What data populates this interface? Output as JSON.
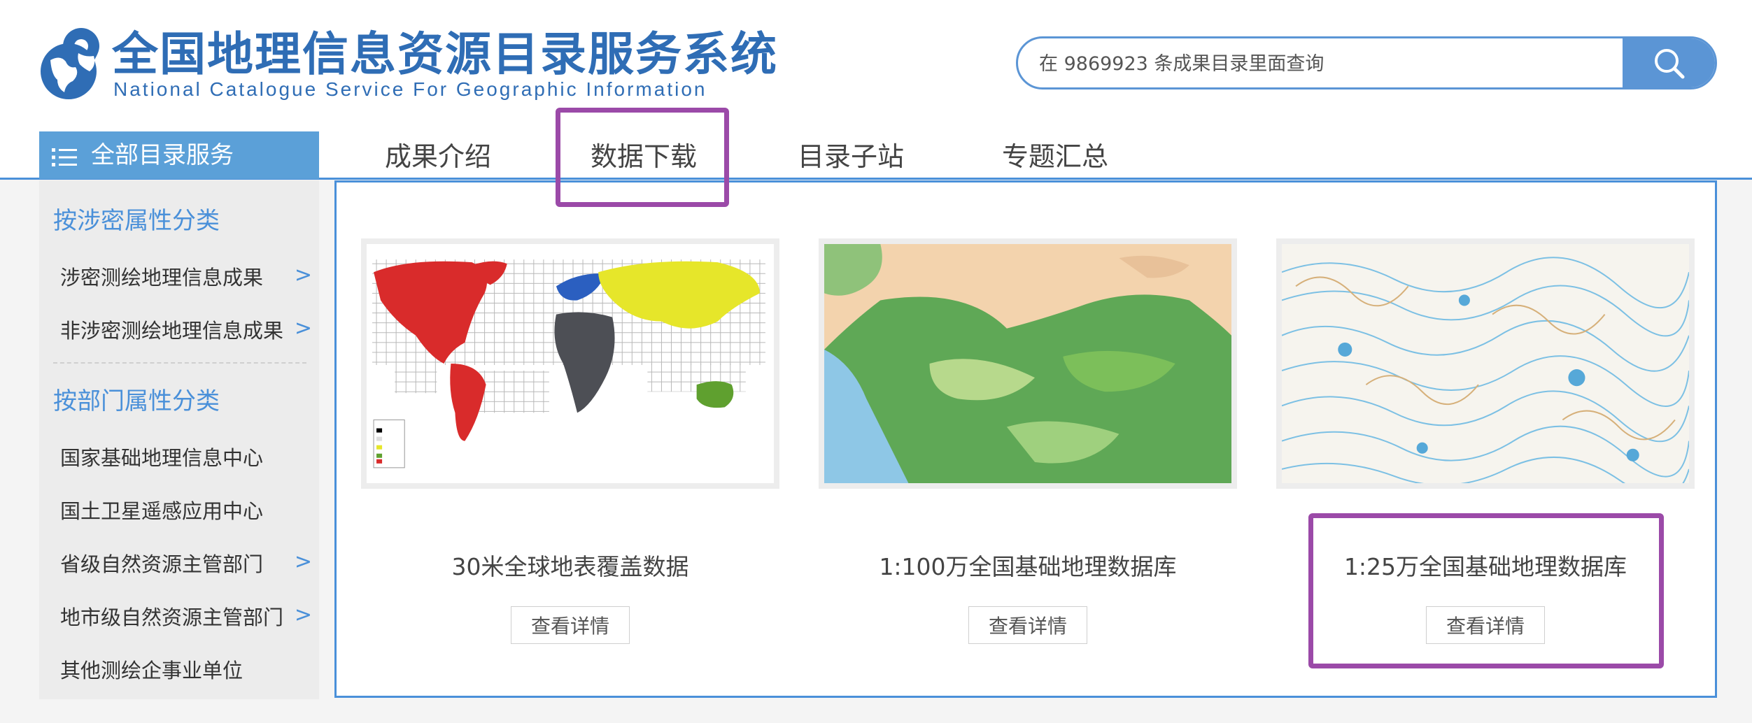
{
  "header": {
    "logo_title": "全国地理信息资源目录服务系统",
    "logo_subtitle": "National Catalogue Service For Geographic Information"
  },
  "search": {
    "placeholder": "在 9869923 条成果目录里面查询",
    "button_icon": "search-icon"
  },
  "category_menu": {
    "label": "全部目录服务",
    "icon": "list-icon"
  },
  "nav": {
    "tabs": [
      {
        "label": "成果介绍"
      },
      {
        "label": "数据下载"
      },
      {
        "label": "目录子站"
      },
      {
        "label": "专题汇总"
      }
    ]
  },
  "sidebar": {
    "section1": {
      "title": "按涉密属性分类",
      "items": [
        {
          "label": "涉密测绘地理信息成果",
          "chevron": ">"
        },
        {
          "label": "非涉密测绘地理信息成果",
          "chevron": ">"
        }
      ]
    },
    "section2": {
      "title": "按部门属性分类",
      "items": [
        {
          "label": "国家基础地理信息中心"
        },
        {
          "label": "国土卫星遥感应用中心"
        },
        {
          "label": "省级自然资源主管部门",
          "chevron": ">"
        },
        {
          "label": "地市级自然资源主管部门",
          "chevron": ">"
        },
        {
          "label": "其他测绘企事业单位"
        }
      ]
    }
  },
  "cards": [
    {
      "title": "30米全球地表覆盖数据",
      "button": "查看详情",
      "image": "world-map-image"
    },
    {
      "title": "1:100万全国基础地理数据库",
      "button": "查看详情",
      "image": "terrain-map-image"
    },
    {
      "title": "1:25万全国基础地理数据库",
      "button": "查看详情",
      "image": "contour-map-image"
    }
  ],
  "colors": {
    "accent": "#4a90d9",
    "brand": "#2f6db5",
    "highlight": "#9b4aa8"
  }
}
